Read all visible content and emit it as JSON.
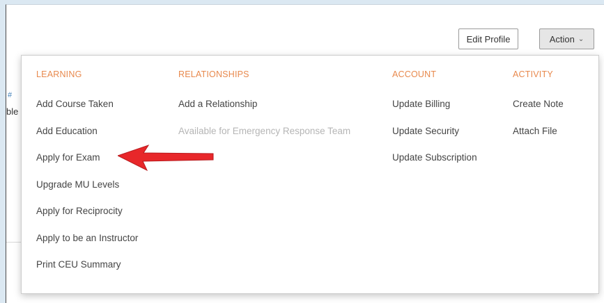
{
  "toolbar": {
    "edit_profile_label": "Edit Profile",
    "action_label": "Action"
  },
  "background": {
    "edge_marker": "#",
    "edge_text": "ble"
  },
  "menu": {
    "learning": {
      "heading": "LEARNING",
      "items": [
        {
          "label": "Add Course Taken"
        },
        {
          "label": "Add Education"
        },
        {
          "label": "Apply for Exam"
        },
        {
          "label": "Upgrade MU Levels"
        },
        {
          "label": "Apply for Reciprocity"
        },
        {
          "label": "Apply to be an Instructor"
        },
        {
          "label": "Print CEU Summary"
        }
      ]
    },
    "relationships": {
      "heading": "RELATIONSHIPS",
      "items": [
        {
          "label": "Add a Relationship"
        },
        {
          "label": "Available for Emergency Response Team",
          "disabled": true
        }
      ]
    },
    "account": {
      "heading": "ACCOUNT",
      "items": [
        {
          "label": "Update Billing"
        },
        {
          "label": "Update Security"
        },
        {
          "label": "Update Subscription"
        }
      ]
    },
    "activity": {
      "heading": "ACTIVITY",
      "items": [
        {
          "label": "Create Note"
        },
        {
          "label": "Attach File"
        }
      ]
    }
  },
  "colors": {
    "heading": "#e8894d",
    "arrow": "#e8272a",
    "background": "#dbe8f2"
  },
  "annotation": {
    "icon": "red-arrow-icon",
    "points_to": "Apply for Exam"
  }
}
